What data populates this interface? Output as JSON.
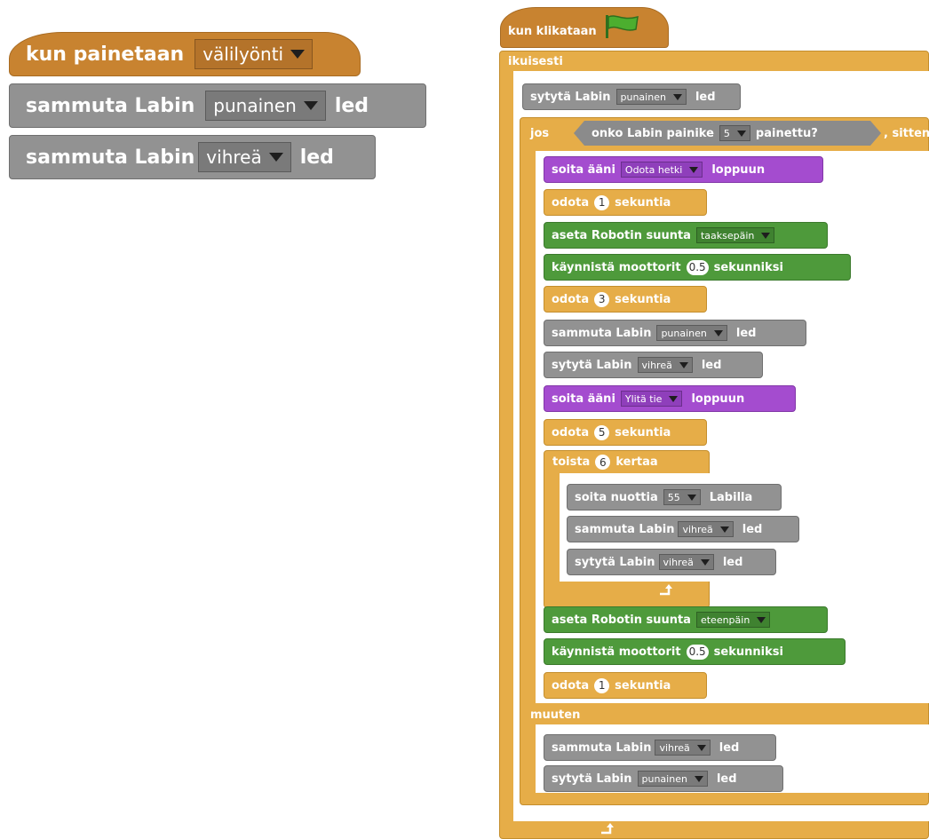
{
  "event_script": {
    "hat_prefix": "kun painetaan",
    "hat_key": "välilyönti",
    "off1_prefix": "sammuta Labin",
    "off1_value": "punainen",
    "off1_suffix": "led",
    "off2_prefix": "sammuta Labin",
    "off2_value": "vihreä",
    "off2_suffix": "led"
  },
  "flag_script": {
    "hat_label": "kun klikataan",
    "forever_label": "ikuisesti",
    "led_on_prefix": "sytytä Labin",
    "led_on_value": "punainen",
    "led_on_suffix": "led",
    "if_label": "jos",
    "cond_prefix": "onko Labin painike",
    "cond_value": "5",
    "cond_suffix": "painettu?",
    "then_label": ", sitten",
    "b1": {
      "prefix": "soita ääni",
      "value": "Odota hetki",
      "suffix": "loppuun"
    },
    "b2": {
      "prefix": "odota",
      "value": "1",
      "suffix": "sekuntia"
    },
    "b3": {
      "prefix": "aseta Robotin suunta",
      "value": "taaksepäin"
    },
    "b4": {
      "prefix": "käynnistä moottorit",
      "value": "0.5",
      "suffix": "sekunniksi"
    },
    "b5": {
      "prefix": "odota",
      "value": "3",
      "suffix": "sekuntia"
    },
    "b6": {
      "prefix": "sammuta Labin",
      "value": "punainen",
      "suffix": "led"
    },
    "b7": {
      "prefix": "sytytä Labin",
      "value": "vihreä",
      "suffix": "led"
    },
    "b8": {
      "prefix": "soita ääni",
      "value": "Ylitä tie",
      "suffix": "loppuun"
    },
    "b9": {
      "prefix": "odota",
      "value": "5",
      "suffix": "sekuntia"
    },
    "repeat": {
      "prefix": "toista",
      "value": "6",
      "suffix": "kertaa"
    },
    "r1": {
      "prefix": "soita nuottia",
      "value": "55",
      "suffix": "Labilla"
    },
    "r2": {
      "prefix": "sammuta Labin",
      "value": "vihreä",
      "suffix": "led"
    },
    "r3": {
      "prefix": "sytytä Labin",
      "value": "vihreä",
      "suffix": "led"
    },
    "b10": {
      "prefix": "aseta Robotin suunta",
      "value": "eteenpäin"
    },
    "b11": {
      "prefix": "käynnistä moottorit",
      "value": "0.5",
      "suffix": "sekunniksi"
    },
    "b12": {
      "prefix": "odota",
      "value": "1",
      "suffix": "sekuntia"
    },
    "else_label": "muuten",
    "e1": {
      "prefix": "sammuta Labin",
      "value": "vihreä",
      "suffix": "led"
    },
    "e2": {
      "prefix": "sytytä Labin",
      "value": "punainen",
      "suffix": "led"
    }
  },
  "icons": {
    "flag": "green-flag-icon",
    "loop_arrow": "loop-arrow-icon",
    "dropdown": "chevron-down-icon"
  },
  "colors": {
    "events": "#c88330",
    "control": "#e6ad48",
    "lab": "#929292",
    "motion": "#4e9a3b",
    "sound": "#a44ccf"
  }
}
